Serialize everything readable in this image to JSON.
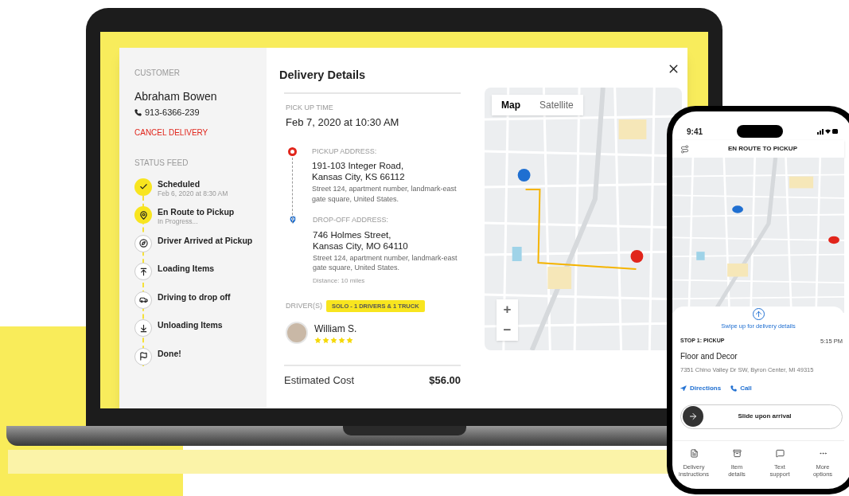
{
  "laptop": {
    "customer": {
      "label": "CUSTOMER",
      "name": "Abraham Bowen",
      "phone": "913-6366-239",
      "cancel": "CANCEL DELIVERY"
    },
    "status_feed": {
      "label": "STATUS FEED",
      "items": [
        {
          "kind": "check",
          "title": "Scheduled",
          "subtitle": "Feb 6, 2020 at 8:30 AM",
          "highlighted": true
        },
        {
          "kind": "pin",
          "title": "En Route to Pickup",
          "subtitle": "In Progress...",
          "highlighted": true
        },
        {
          "kind": "compass",
          "title": "Driver Arrived at Pickup",
          "highlighted": false
        },
        {
          "kind": "upload",
          "title": "Loading Items",
          "highlighted": false
        },
        {
          "kind": "car",
          "title": "Driving to drop off",
          "highlighted": false
        },
        {
          "kind": "download",
          "title": "Unloading Items",
          "highlighted": false
        },
        {
          "kind": "flag",
          "title": "Done!",
          "highlighted": false
        }
      ]
    },
    "details": {
      "title": "Delivery Details",
      "pickup_time_label": "PICK UP TIME",
      "pickup_time": "Feb 7, 2020 at 10:30 AM",
      "stops": [
        {
          "kind": "pickup",
          "label": "PICKUP ADDRESS:",
          "line1": "191-103 Integer Road,",
          "line2": "Kansas City, KS 66112",
          "note": "Street 124, apartment number, landmark-east gate square, United States."
        },
        {
          "kind": "dropoff",
          "label": "DROP-OFF ADDRESS:",
          "line1": "746 Holmes Street,",
          "line2": "Kansas City, MO 64110",
          "note": "Street 124, apartment number, landmark-east gate square, United States.",
          "distance": "Distance: 10 miles"
        }
      ],
      "drivers_label": "DRIVER(S)",
      "drivers_badge": "SOLO - 1 DRIVERS & 1 TRUCK",
      "driver": {
        "name": "William S.",
        "stars": 5
      },
      "cost_label": "Estimated Cost",
      "cost": "$56.00"
    },
    "map": {
      "tabs": [
        {
          "label": "Map",
          "selected": true
        },
        {
          "label": "Satellite",
          "selected": false
        }
      ],
      "zoom_in": "+",
      "zoom_out": "−"
    }
  },
  "phone": {
    "time": "9:41",
    "title": "EN ROUTE TO PICKUP",
    "swipe_hint": "Swipe up for delivery details",
    "stop_label": "STOP 1: PICKUP",
    "stop_time": "5:15 PM",
    "place": "Floor and Decor",
    "address": "7351 Chino Valley Dr SW, Byron Center, MI 49315",
    "actions": [
      {
        "kind": "directions",
        "label": "Directions"
      },
      {
        "kind": "call",
        "label": "Call"
      }
    ],
    "slider": "Slide upon arrival",
    "nav": [
      {
        "kind": "document",
        "line1": "Delivery",
        "line2": "instructions"
      },
      {
        "kind": "box",
        "line1": "Item",
        "line2": "details"
      },
      {
        "kind": "chat",
        "line1": "Text",
        "line2": "support"
      },
      {
        "kind": "more",
        "line1": "More",
        "line2": "options"
      }
    ]
  }
}
